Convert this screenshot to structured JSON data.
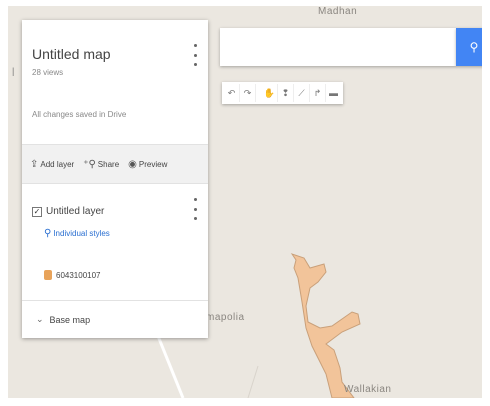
{
  "map_labels": {
    "top": "Madhan",
    "middle": "mapolia",
    "bottom": "Wallakian"
  },
  "panel": {
    "title": "Untitled map",
    "views": "28 views",
    "saved_status": "All changes saved in Drive",
    "actions": {
      "add_layer": "Add layer",
      "share": "Share",
      "preview": "Preview"
    },
    "layer": {
      "name": "Untitled layer",
      "style": "Individual styles",
      "feature": "6043100107"
    },
    "base_map": "Base map"
  },
  "search": {
    "value": "",
    "placeholder": ""
  },
  "toolbar": {
    "tools": [
      "undo-icon",
      "redo-icon",
      "hand-icon",
      "marker-icon",
      "draw-line-icon",
      "directions-icon",
      "ruler-icon"
    ]
  },
  "colors": {
    "map_background": "#ebe7e0",
    "polygon_fill": "#f2c49a",
    "polygon_stroke": "#c9a07a",
    "accent": "#4285f4",
    "link": "#2a6fd1"
  }
}
